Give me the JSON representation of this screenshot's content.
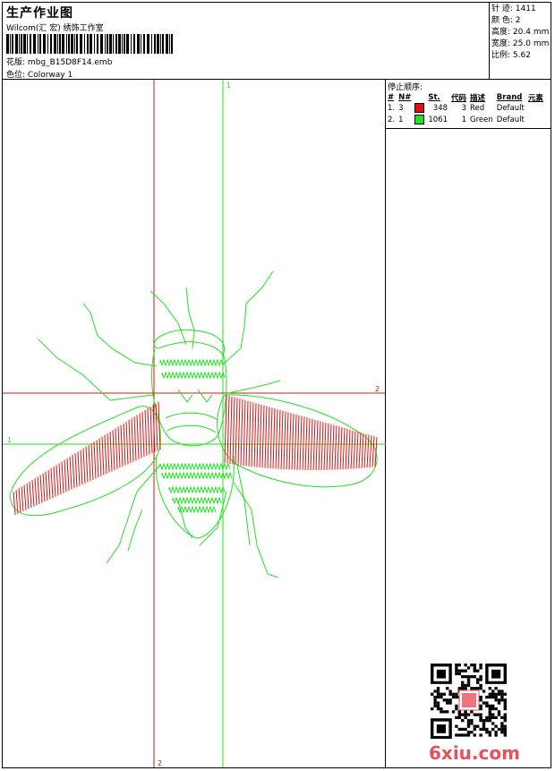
{
  "header": {
    "title": "生产作业图",
    "studio": "Wilcom(汇 宏) 绣饰工作室",
    "design_label": "花版:",
    "design_file": "mbg_B15D8F14.emb",
    "colorway_label": "色位:",
    "colorway": "Colorway 1"
  },
  "stats": [
    {
      "label": "针 迹:",
      "value": "1411"
    },
    {
      "label": "颜 色:",
      "value": "2"
    },
    {
      "label": "高度:",
      "value": "20.4 mm"
    },
    {
      "label": "宽度:",
      "value": "25.0 mm"
    },
    {
      "label": "比例:",
      "value": "5.62"
    }
  ],
  "stop_sequence": {
    "heading": "停止顺序:",
    "columns": [
      "#",
      "N#",
      "St.",
      "代码",
      "描述",
      "Brand",
      "元素"
    ],
    "rows": [
      {
        "index": "1.",
        "needle": "3",
        "color": "#e01010",
        "stitches": "348",
        "code": "3",
        "description": "Red",
        "brand": "Default"
      },
      {
        "index": "2.",
        "needle": "1",
        "color": "#22e022",
        "stitches": "1061",
        "code": "1",
        "description": "Green",
        "brand": "Default"
      }
    ]
  },
  "guides": {
    "green_vertical_label": "1",
    "green_horizontal_label": "1",
    "red_horizontal_label": "2",
    "red_vertical_label": "2"
  },
  "colors": {
    "red_thread": "#e01010",
    "green_thread": "#22e022",
    "watermark": "#e8505b"
  },
  "watermark": "6xiu.com"
}
